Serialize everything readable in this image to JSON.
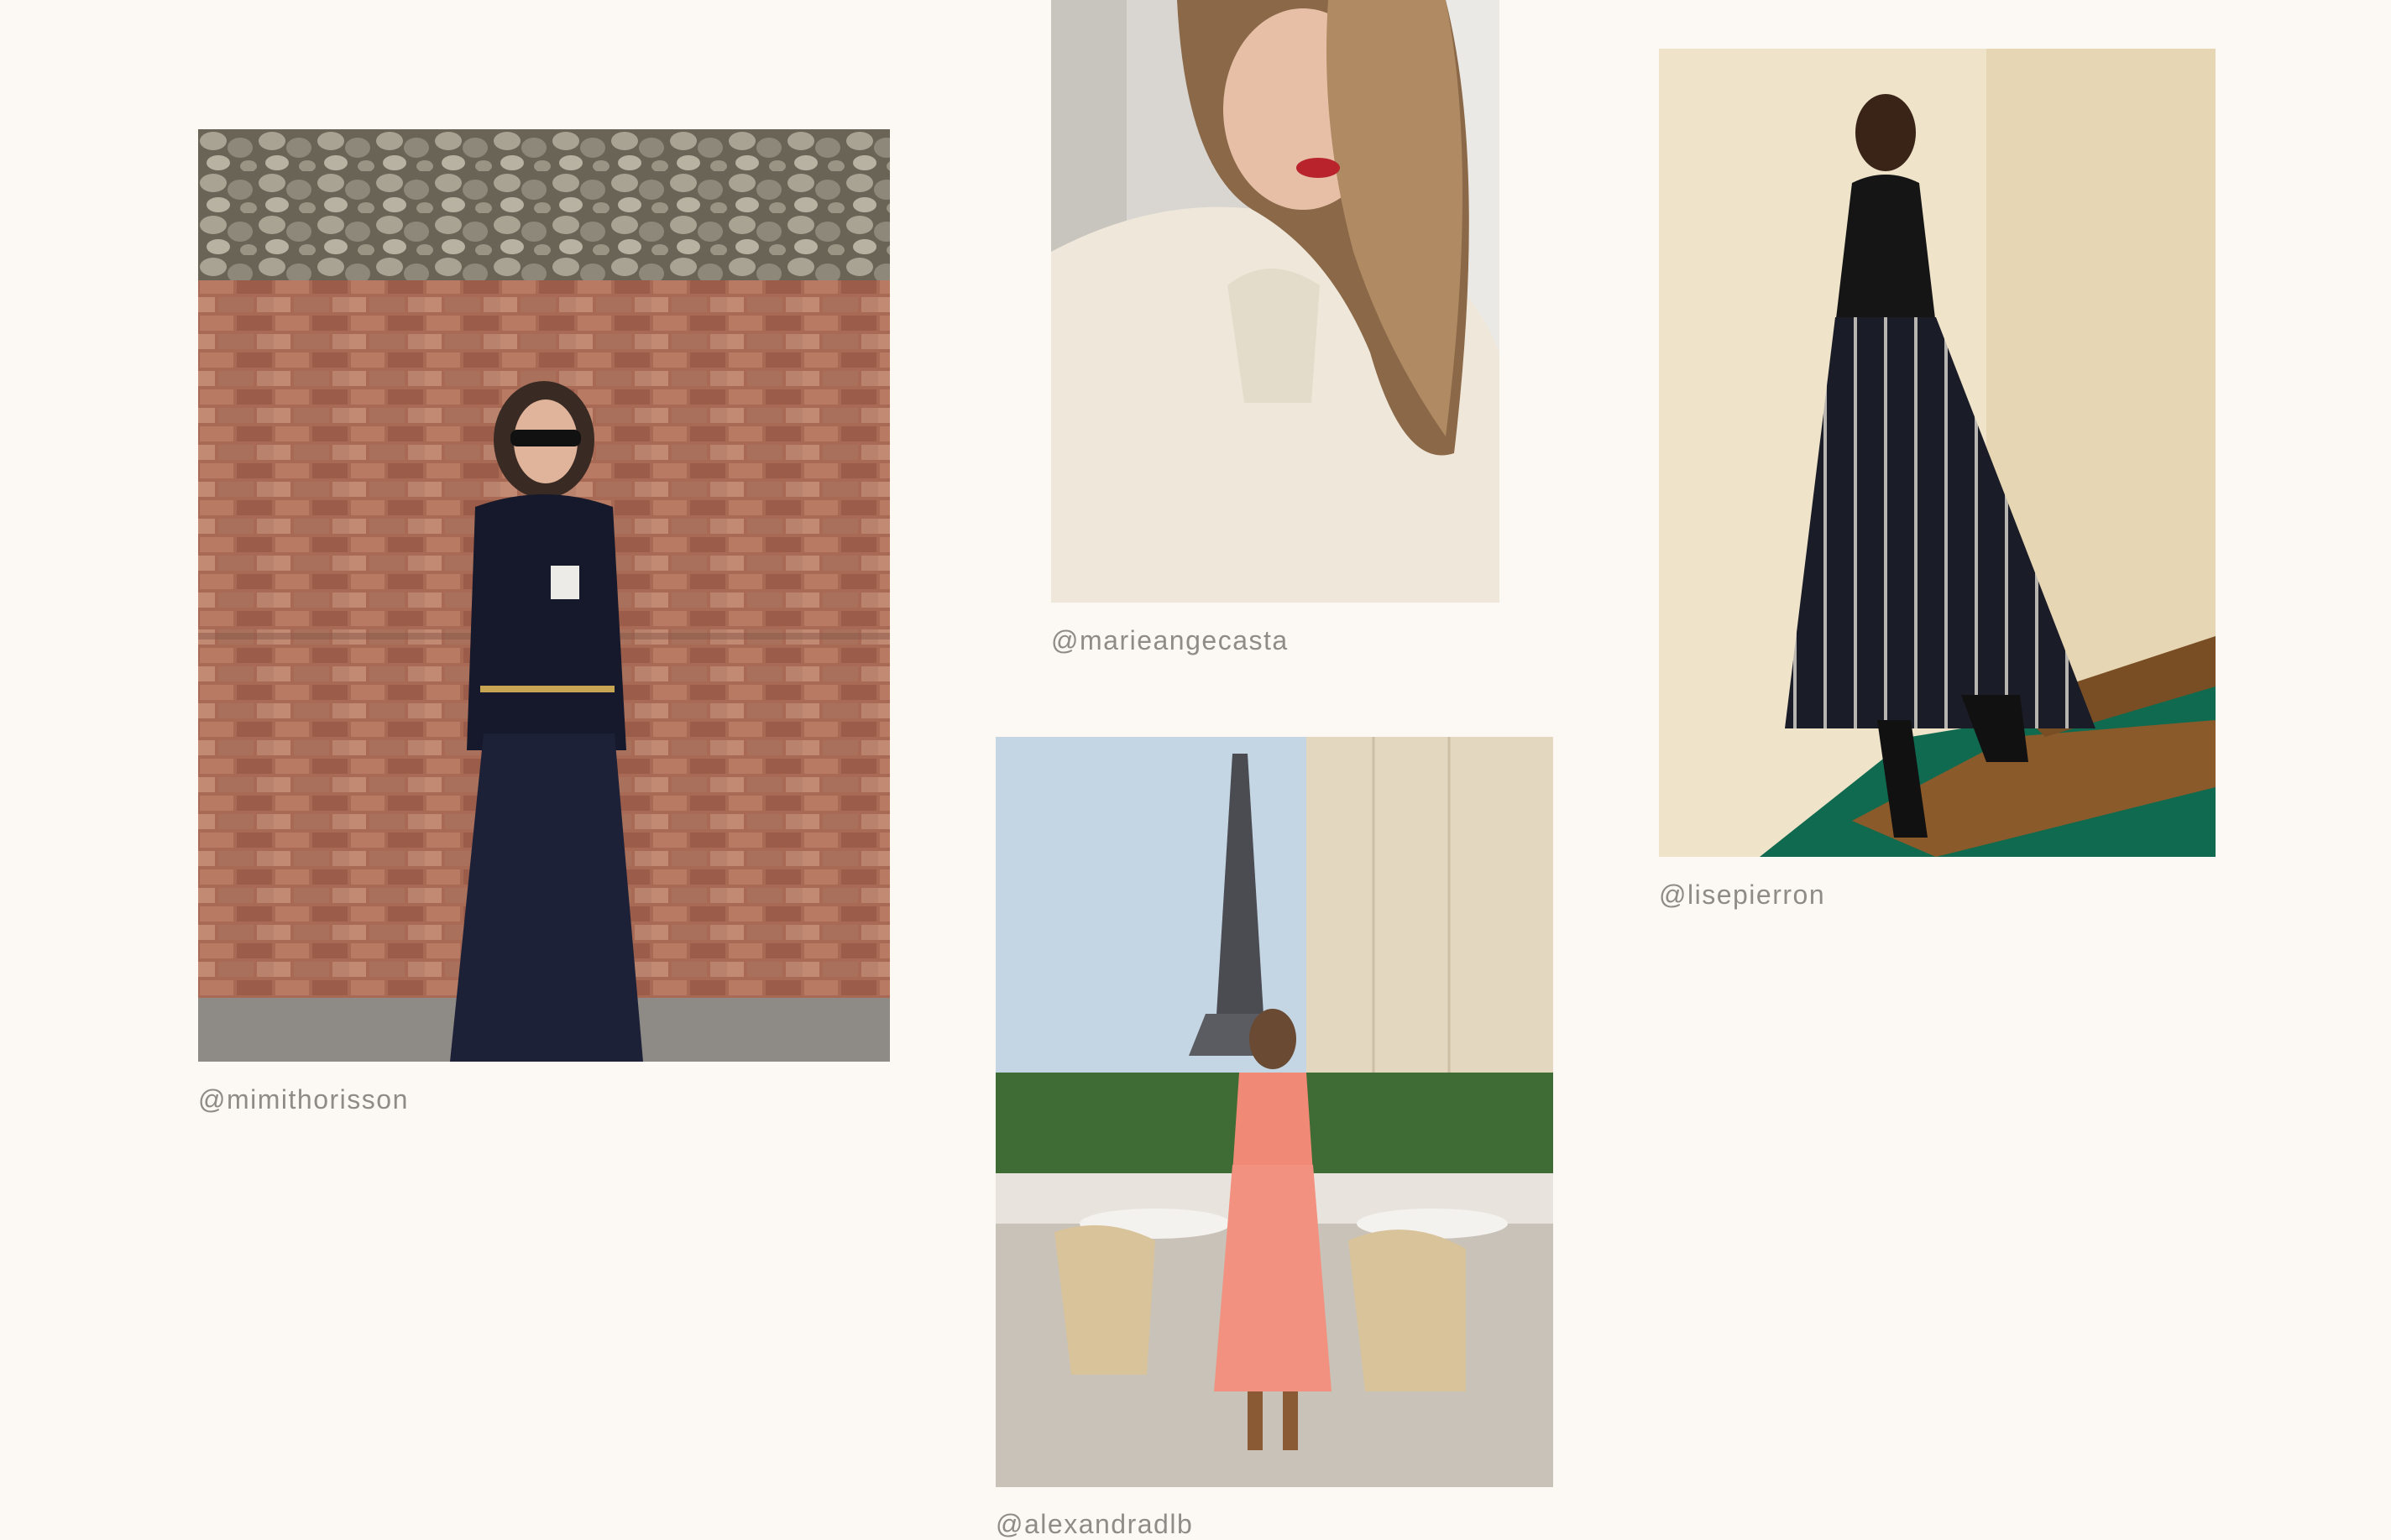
{
  "gallery": {
    "items": [
      {
        "handle": "@mimithorisson"
      },
      {
        "handle": "@marieangecasta"
      },
      {
        "handle": "@lisepierron"
      },
      {
        "handle": "@alexandradlb"
      }
    ]
  },
  "colors": {
    "background": "#fcf8f3",
    "handle_text": "#8f8c88"
  }
}
